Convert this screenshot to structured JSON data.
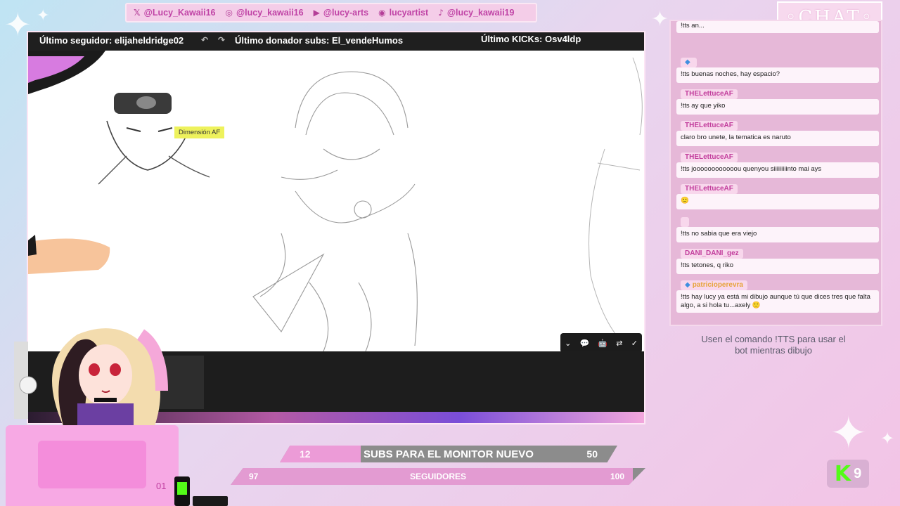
{
  "socials": [
    {
      "icon": "x-icon",
      "glyph": "𝕏",
      "handle": "@Lucy_Kawaii16"
    },
    {
      "icon": "instagram-icon",
      "glyph": "◎",
      "handle": "@lucy_kawaii16"
    },
    {
      "icon": "youtube-icon",
      "glyph": "▶",
      "handle": "@lucy-arts"
    },
    {
      "icon": "discord-icon",
      "glyph": "◉",
      "handle": "lucyartist"
    },
    {
      "icon": "tiktok-icon",
      "glyph": "♪",
      "handle": "@lucy_kawaii19"
    }
  ],
  "chat_header": "◦CHAT◦",
  "overlay": {
    "last_follower": "Último seguidor: elijaheldridge02",
    "last_donor": "Último donador subs: El_vendeHumos",
    "last_kick": "Último KICKs: Osv4ldp"
  },
  "canvas": {
    "layer_tooltip": "Dimensión AF",
    "add_glyph": "+"
  },
  "chat": [
    {
      "user": "",
      "text": "!tts an..."
    },
    {
      "user": "",
      "text": "!tts buenas noches, hay espacio?"
    },
    {
      "user": "THELettuceAF",
      "text": "!tts ay que yiko"
    },
    {
      "user": "THELettuceAF",
      "text": "claro bro unete, la tematica es naruto"
    },
    {
      "user": "THELettuceAF",
      "text": "!tts joooooooooooou quenyou siiiiiiiiinto mai ays"
    },
    {
      "user": "THELettuceAF",
      "text": "🙂"
    },
    {
      "user": "",
      "text": "!tts no sabia que era viejo"
    },
    {
      "user": "DANI_DANI_gez",
      "text": "!tts tetones, q riko"
    },
    {
      "user": "patricioperevra",
      "text": "!tts hay lucy ya está mi dibujo aunque tú que dices tres que falta algo, a si hola tu...axely 🙂"
    }
  ],
  "tts_hint": "Usen el comando !TTS para usar el bot mientras dibujo",
  "goals": {
    "subs": {
      "current": "12",
      "title": "SUBS PARA EL MONITOR NUEVO",
      "target": "50",
      "progress": 0.24
    },
    "followers": {
      "current": "97",
      "title": "SEGUIDORES",
      "target": "100",
      "progress": 0.97
    }
  },
  "kick": {
    "logo": "K",
    "viewers": "9"
  },
  "desk_counter": "01",
  "colors": {
    "accent": "#c044a6",
    "kick_green": "#53fc18",
    "goal_fill": "#ec9bd7"
  }
}
